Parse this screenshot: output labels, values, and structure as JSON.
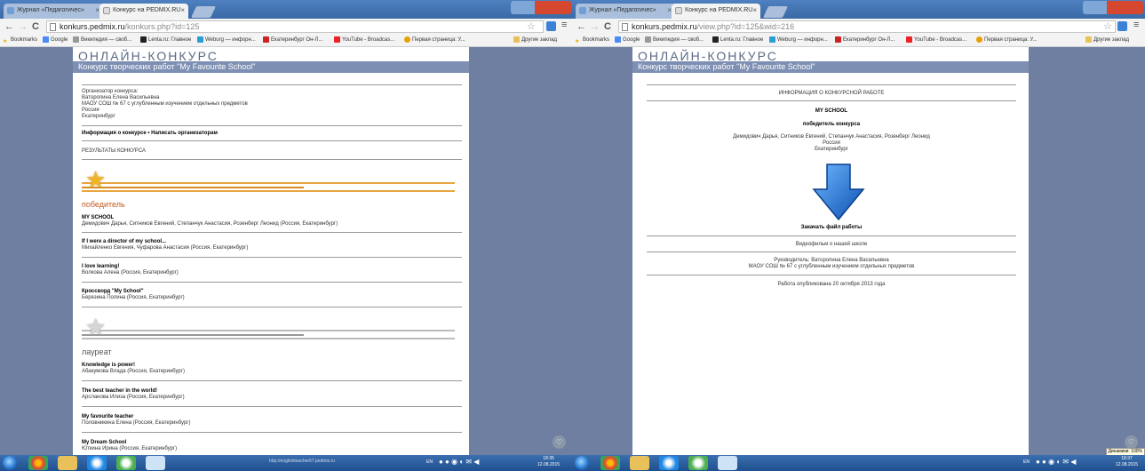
{
  "left": {
    "tabs": [
      {
        "label": "Журнал «Педагогичес»",
        "active": false
      },
      {
        "label": "Конкурс на PEDMIX.RU",
        "active": true
      }
    ],
    "url": {
      "host": "konkurs.pedmix.ru",
      "path": "/konkurs.php?id=125"
    },
    "bookmarks_label": "Bookmarks",
    "bookmarks": [
      "Google",
      "Википедия — своб...",
      "Lenta.ru: Главное",
      "Weburg — инфорн...",
      "Екатеринбург Он-Л...",
      "YouTube - Broadcas...",
      "Первая страница: У..."
    ],
    "other_bookmarks": "Другие заклад",
    "site": {
      "logo": "ОНЛАЙН-КОНКУРС",
      "banner": "Конкурс творческих работ \"My Favourite School\"",
      "organizer": [
        "Организатор конкурса:",
        "Ваторопина Елена Васильевна",
        "МАОУ СОШ № 67 с углубленным изучением отдельных предметов",
        "Россия",
        "Екатеринбург"
      ],
      "links": "Информация о конкурсе • Написать организаторам",
      "results": "РЕЗУЛЬТАТЫ КОНКУРСА",
      "winner_heading": "победитель",
      "winners": [
        {
          "title": "MY SCHOOL",
          "authors": "Демидович Дарья, Ситников Евгений, Степанчук Анастасия, Розенберг Леонид (Россия, Екатеринбург)"
        },
        {
          "title": "If I were a director of my school...",
          "authors": "Михайленко Евгения, Чуфарова Анастасия (Россия, Екатеринбург)"
        },
        {
          "title": "I love learning!",
          "authors": "Волкова Алена (Россия, Екатеринбург)"
        },
        {
          "title": "Кроссворд \"My School\"",
          "authors": "Березина Полина (Россия, Екатеринбург)"
        }
      ],
      "laureate_heading": "лауреат",
      "laureates": [
        {
          "title": "Knowledge is power!",
          "authors": "Абакумова Влада (Россия, Екатеринбург)"
        },
        {
          "title": "The best teacher in the world!",
          "authors": "Арсланова Илиза (Россия, Екатеринбург)"
        },
        {
          "title": "My favourite teacher",
          "authors": "Половникина Елена (Россия, Екатеринбург)"
        },
        {
          "title": "My Dream School",
          "authors": "Юткина Ирина (Россия, Екатеринбург)"
        }
      ]
    },
    "taskbar_url": "http://englishteacher67.pedmix.ru",
    "tray_lang": "EN",
    "clock_time": "18:35",
    "clock_date": "12.08.2015"
  },
  "right": {
    "tabs": [
      {
        "label": "Журнал «Педагогичес»",
        "active": false
      },
      {
        "label": "Конкурс на PEDMIX.RU",
        "active": true
      }
    ],
    "url": {
      "host": "konkurs.pedmix.ru",
      "path": "/view.php?id=125&wid=216"
    },
    "bookmarks_label": "Bookmarks",
    "bookmarks": [
      "Google",
      "Википедия — своб...",
      "Lenta.ru: Главное",
      "Weburg — инфорн...",
      "Екатеринбург Он-Л...",
      "YouTube - Broadcas...",
      "Первая страница: У..."
    ],
    "other_bookmarks": "Другие заклад",
    "site": {
      "logo": "ОНЛАЙН-КОНКУРС",
      "banner": "Конкурс творческих работ \"My Favourite School\"",
      "info_heading": "ИНФОРМАЦИЯ О КОНКУРСНОЙ РАБОТЕ",
      "work_title": "MY SCHOOL",
      "status": "победитель конкурса",
      "authors": "Демидович Дарья, Ситников Евгений, Степанчук Анастасия, Розенберг Леонид",
      "country": "Россия",
      "city": "Екатеринбург",
      "download": "Закачать файл работы",
      "description": "Видеофильм о нашей школе",
      "supervisor": "Руководитель: Ваторопина Елена Васильевна",
      "school": "МАОУ СОШ № 67 с углубленным изучением отдельных предметов",
      "published": "Работа опубликована 20 октября 2013 года"
    },
    "tray_lang": "EN",
    "clock_time": "18:37",
    "clock_date": "12.08.2015",
    "tooltip": "Динамики: 100%"
  },
  "colors": {
    "banner": "#7d8fb3",
    "page_bg": "#6e7fa1",
    "winner_heading": "#c25a1e",
    "arrow": "#1f6fd0"
  }
}
